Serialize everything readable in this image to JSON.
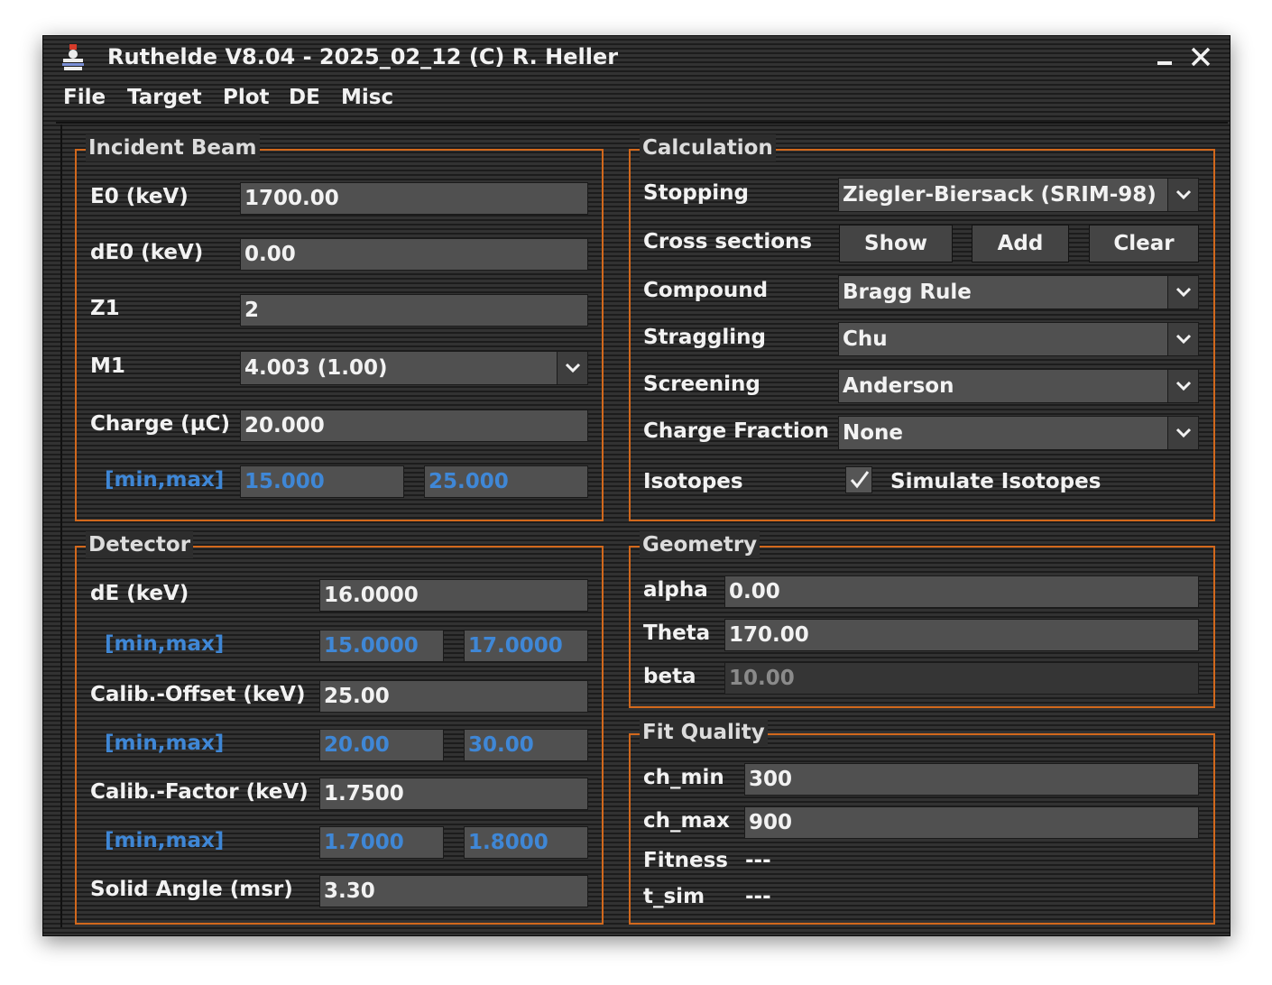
{
  "window": {
    "title": "Ruthelde V8.04 - 2025_02_12 (C) R. Heller"
  },
  "menu": [
    "File",
    "Target",
    "Plot",
    "DE",
    "Misc"
  ],
  "incident_beam": {
    "legend": "Incident Beam",
    "e0": {
      "label": "E0 (keV)",
      "value": "1700.00"
    },
    "de0": {
      "label": "dE0 (keV)",
      "value": "0.00"
    },
    "z1": {
      "label": "Z1",
      "value": "2"
    },
    "m1": {
      "label": "M1",
      "value": "4.003 (1.00)"
    },
    "charge": {
      "label": "Charge (µC)",
      "value": "20.000"
    },
    "charge_range": {
      "label": "[min,max]",
      "min": "15.000",
      "max": "25.000"
    }
  },
  "calculation": {
    "legend": "Calculation",
    "stopping": {
      "label": "Stopping",
      "value": "Ziegler-Biersack (SRIM-98)"
    },
    "cross_sections": {
      "label": "Cross sections",
      "show": "Show",
      "add": "Add",
      "clear": "Clear"
    },
    "compound": {
      "label": "Compound",
      "value": "Bragg Rule"
    },
    "straggling": {
      "label": "Straggling",
      "value": "Chu"
    },
    "screening": {
      "label": "Screening",
      "value": "Anderson"
    },
    "charge_fraction": {
      "label": "Charge Fraction",
      "value": "None"
    },
    "isotopes": {
      "label": "Isotopes",
      "checkbox_label": "Simulate Isotopes",
      "checked": true
    }
  },
  "detector": {
    "legend": "Detector",
    "de": {
      "label": "dE (keV)",
      "value": "16.0000"
    },
    "de_range": {
      "label": "[min,max]",
      "min": "15.0000",
      "max": "17.0000"
    },
    "offset": {
      "label": "Calib.-Offset (keV)",
      "value": "25.00"
    },
    "offset_range": {
      "label": "[min,max]",
      "min": "20.00",
      "max": "30.00"
    },
    "factor": {
      "label": "Calib.-Factor (keV)",
      "value": "1.7500"
    },
    "factor_range": {
      "label": "[min,max]",
      "min": "1.7000",
      "max": "1.8000"
    },
    "solid_angle": {
      "label": "Solid Angle (msr)",
      "value": "3.30"
    }
  },
  "geometry": {
    "legend": "Geometry",
    "alpha": {
      "label": "alpha",
      "value": "0.00"
    },
    "theta": {
      "label": "Theta",
      "value": "170.00"
    },
    "beta": {
      "label": "beta",
      "value": "10.00"
    }
  },
  "fit_quality": {
    "legend": "Fit Quality",
    "ch_min": {
      "label": "ch_min",
      "value": "300"
    },
    "ch_max": {
      "label": "ch_max",
      "value": "900"
    },
    "fitness": {
      "label": "Fitness",
      "value": "---"
    },
    "t_sim": {
      "label": "t_sim",
      "value": "---"
    }
  },
  "colors": {
    "accent": "#d2681c",
    "range_text": "#3f87d6",
    "background": "#2d2d2d",
    "field": "#505050"
  }
}
